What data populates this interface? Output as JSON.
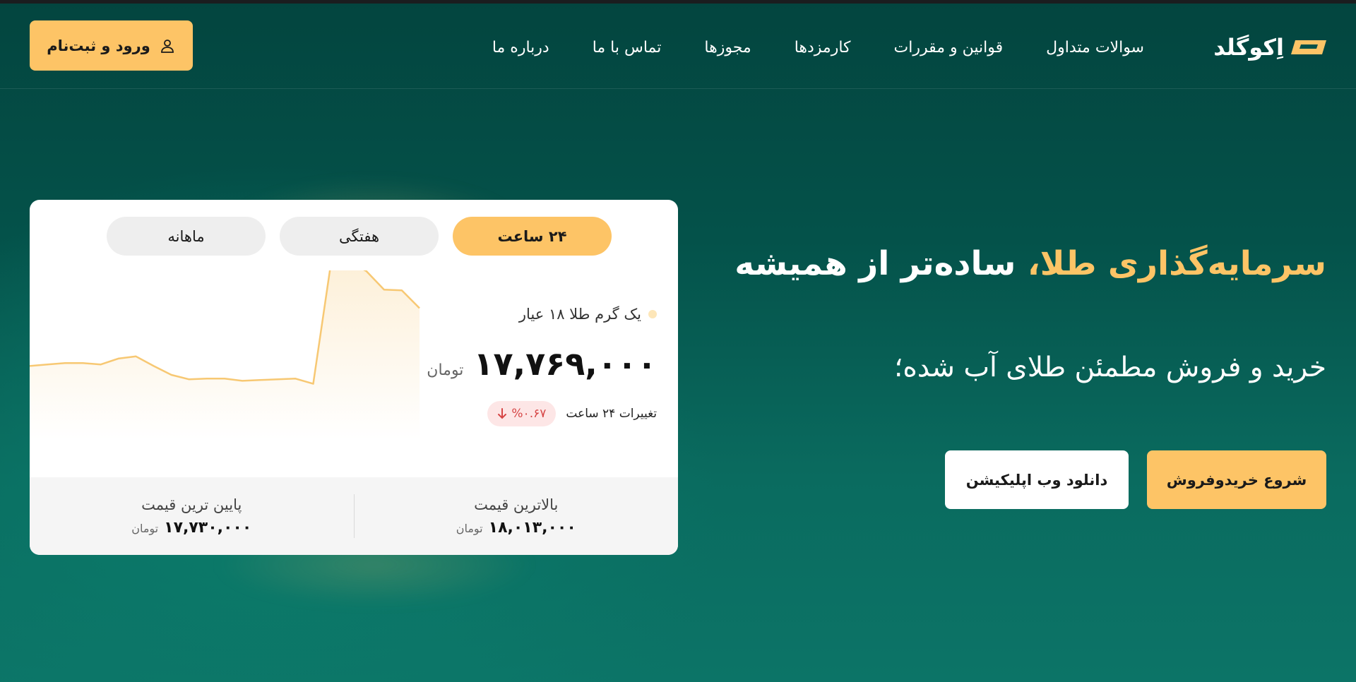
{
  "brand": {
    "name": "اِکوگلد",
    "accent": "#fdc466",
    "logo_icon": "logo-mark-icon"
  },
  "nav": {
    "items": [
      {
        "label": "سوالات متداول"
      },
      {
        "label": "قوانین و مقررات"
      },
      {
        "label": "کارمزدها"
      },
      {
        "label": "مجوزها"
      },
      {
        "label": "تماس با ما"
      },
      {
        "label": "درباره ما"
      }
    ]
  },
  "auth": {
    "login_label": "ورود و ثبت‌نام",
    "icon": "user-icon"
  },
  "hero": {
    "title_gold": "سرمایه‌گذاری طلا،",
    "title_white": "ساده‌تر از همیشه",
    "subtitle": "خرید و فروش مطمئن طلای آب شده؛",
    "start_label": "شروع خریدوفروش",
    "download_label": "دانلود وب اپلیکیشن"
  },
  "price_card": {
    "tabs": [
      {
        "label": "۲۴ ساعت",
        "active": true
      },
      {
        "label": "هفتگی",
        "active": false
      },
      {
        "label": "ماهانه",
        "active": false
      }
    ],
    "asset_label": "یک گرم طلا ۱۸ عیار",
    "price": "۱۷,۷۶۹,۰۰۰",
    "unit": "تومان",
    "change_label": "تغییرات ۲۴ ساعت",
    "change_value": "%۰.۶۷",
    "change_color": "#d64545",
    "high_label": "بالاترین قیمت",
    "high_value": "۱۸,۰۱۳,۰۰۰",
    "low_label": "پایین ترین قیمت",
    "low_value": "۱۷,۷۳۰,۰۰۰",
    "stat_unit": "تومان"
  },
  "chart_data": {
    "type": "area",
    "title": "",
    "xlabel": "",
    "ylabel": "",
    "color": "#f7c873",
    "values": [
      17752000,
      17754000,
      17756000,
      17756000,
      17754000,
      17762000,
      17765000,
      17752000,
      17740000,
      17734000,
      17735000,
      17735000,
      17732000,
      17733000,
      17734000,
      17735000,
      17728000,
      17890000,
      17893000,
      17880000,
      17855000,
      17854000,
      17830000
    ],
    "ylim": [
      17700000,
      17900000
    ]
  }
}
